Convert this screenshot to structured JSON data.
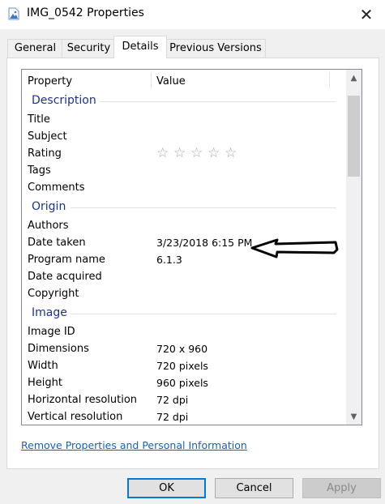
{
  "window": {
    "title": "IMG_0542 Properties"
  },
  "tabs": [
    {
      "label": "General"
    },
    {
      "label": "Security"
    },
    {
      "label": "Details",
      "active": true
    },
    {
      "label": "Previous Versions"
    }
  ],
  "columns": {
    "property": "Property",
    "value": "Value"
  },
  "sections": {
    "description": {
      "label": "Description",
      "rows": [
        {
          "property": "Title",
          "value": ""
        },
        {
          "property": "Subject",
          "value": ""
        },
        {
          "property": "Rating",
          "value": "",
          "rating_stars": 0,
          "rating_max": 5
        },
        {
          "property": "Tags",
          "value": ""
        },
        {
          "property": "Comments",
          "value": ""
        }
      ]
    },
    "origin": {
      "label": "Origin",
      "rows": [
        {
          "property": "Authors",
          "value": ""
        },
        {
          "property": "Date taken",
          "value": "3/23/2018 6:15 PM"
        },
        {
          "property": "Program name",
          "value": "6.1.3"
        },
        {
          "property": "Date acquired",
          "value": ""
        },
        {
          "property": "Copyright",
          "value": ""
        }
      ]
    },
    "image": {
      "label": "Image",
      "rows": [
        {
          "property": "Image ID",
          "value": ""
        },
        {
          "property": "Dimensions",
          "value": "720 x 960"
        },
        {
          "property": "Width",
          "value": "720 pixels"
        },
        {
          "property": "Height",
          "value": "960 pixels"
        },
        {
          "property": "Horizontal resolution",
          "value": "72 dpi"
        },
        {
          "property": "Vertical resolution",
          "value": "72 dpi"
        }
      ]
    }
  },
  "link": {
    "label": "Remove Properties and Personal Information"
  },
  "buttons": {
    "ok": "OK",
    "cancel": "Cancel",
    "apply": "Apply"
  },
  "colors": {
    "group_heading": "#1e3287",
    "link": "#1a5fb4",
    "default_button_border": "#0078d7"
  },
  "icons": {
    "app": "image-file-icon",
    "close": "close-icon",
    "star": "star-outline-icon",
    "annotation": "arrow-left-annotation"
  }
}
